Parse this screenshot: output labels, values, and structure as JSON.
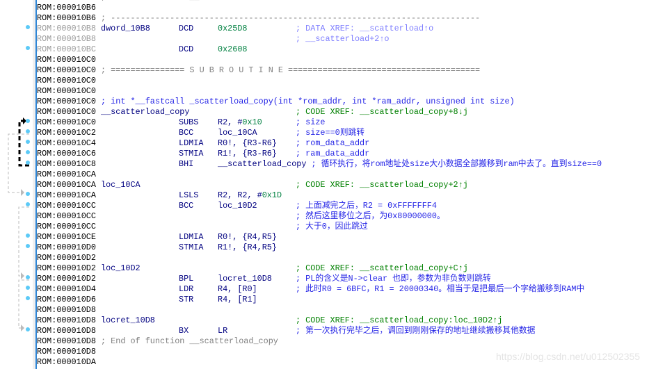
{
  "colors": {
    "address": "#000000",
    "address_dim": "#9a9a9a",
    "label": "#000080",
    "number": "#008040",
    "comment": "#2424e6",
    "xref": "#008000",
    "data_xref": "#8080ff",
    "separator": "#808080",
    "breakpoint_dot": "#5ccaf7",
    "gutter_line": "#2f86d6"
  },
  "rows": [
    {
      "a": "ROM:000010B6",
      "c": "; End of function __scatterload",
      "k": "sep",
      "f": 1
    },
    {
      "a": "ROM:000010B6"
    },
    {
      "a": "ROM:000010B6",
      "c": "; ---------------------------------------------------------------------------",
      "k": "sep",
      "f": 1
    },
    {
      "a": "ROM:000010B8",
      "d": 1,
      "dot": 1,
      "l": "dword_10B8",
      "m": "DCD",
      "o": [
        [
          "0x25D8",
          "num"
        ]
      ],
      "c": "; DATA XREF: __scatterload↑o",
      "k": "dx"
    },
    {
      "a": "ROM:000010B8",
      "d": 1,
      "c": "; __scatterload+2↑o",
      "k": "dx"
    },
    {
      "a": "ROM:000010BC",
      "d": 1,
      "dot": 1,
      "m": "DCD",
      "o": [
        [
          "0x2608",
          "num"
        ]
      ]
    },
    {
      "a": "ROM:000010C0"
    },
    {
      "a": "ROM:000010C0",
      "c": "; =============== S U B R O U T I N E =======================================",
      "k": "sep",
      "f": 1
    },
    {
      "a": "ROM:000010C0"
    },
    {
      "a": "ROM:000010C0"
    },
    {
      "a": "ROM:000010C0",
      "c": "; int *__fastcall _scatterload_copy(int *rom_addr, int *ram_addr, unsigned int size)",
      "k": "proto",
      "f": 1
    },
    {
      "a": "ROM:000010C0",
      "l": "__scatterload_copy",
      "c": "; CODE XREF: __scatterload_copy+8↓j",
      "k": "xref"
    },
    {
      "a": "ROM:000010C0",
      "dot": 1,
      "m": "SUBS",
      "o": [
        [
          "R2, #",
          "reg"
        ],
        [
          "0x10",
          "num"
        ]
      ],
      "c": "; size"
    },
    {
      "a": "ROM:000010C2",
      "dot": 1,
      "m": "BCC",
      "o": [
        [
          "loc_10CA",
          "reg"
        ]
      ],
      "c": "; size==0则跳转"
    },
    {
      "a": "ROM:000010C4",
      "dot": 1,
      "m": "LDMIA",
      "o": [
        [
          "R0!, {R3-R6}",
          "reg"
        ]
      ],
      "c": "; rom_data_addr"
    },
    {
      "a": "ROM:000010C6",
      "dot": 1,
      "m": "STMIA",
      "o": [
        [
          "R1!, {R3-R6}",
          "reg"
        ]
      ],
      "c": "; ram_data_addr"
    },
    {
      "a": "ROM:000010C8",
      "dot": 1,
      "m": "BHI",
      "o": [
        [
          "__scatterload_copy",
          "reg"
        ]
      ],
      "c": "; 循环执行，将rom地址处size大小数据全部搬移到ram中去了。直到size==0"
    },
    {
      "a": "ROM:000010CA"
    },
    {
      "a": "ROM:000010CA",
      "l": "loc_10CA",
      "c": "; CODE XREF: __scatterload_copy+2↑j",
      "k": "xref"
    },
    {
      "a": "ROM:000010CA",
      "dot": 1,
      "m": "LSLS",
      "o": [
        [
          "R2, R2, #",
          "reg"
        ],
        [
          "0x1D",
          "num"
        ]
      ]
    },
    {
      "a": "ROM:000010CC",
      "dot": 1,
      "m": "BCC",
      "o": [
        [
          "loc_10D2",
          "reg"
        ]
      ],
      "c": "; 上面减完之后，R2 = 0xFFFFFFF4"
    },
    {
      "a": "ROM:000010CC",
      "c": "; 然后这里移位之后，为0x80000000。"
    },
    {
      "a": "ROM:000010CC",
      "c": "; 大于0，因此跳过"
    },
    {
      "a": "ROM:000010CE",
      "dot": 1,
      "m": "LDMIA",
      "o": [
        [
          "R0!, {R4,R5}",
          "reg"
        ]
      ]
    },
    {
      "a": "ROM:000010D0",
      "dot": 1,
      "m": "STMIA",
      "o": [
        [
          "R1!, {R4,R5}",
          "reg"
        ]
      ]
    },
    {
      "a": "ROM:000010D2"
    },
    {
      "a": "ROM:000010D2",
      "l": "loc_10D2",
      "c": "; CODE XREF: __scatterload_copy+C↑j",
      "k": "xref"
    },
    {
      "a": "ROM:000010D2",
      "dot": 1,
      "m": "BPL",
      "o": [
        [
          "locret_10D8",
          "reg"
        ]
      ],
      "c": "; PL的含义是N->clear 也即，参数为非负数则跳转"
    },
    {
      "a": "ROM:000010D4",
      "dot": 1,
      "m": "LDR",
      "o": [
        [
          "R4, [R0]",
          "reg"
        ]
      ],
      "c": "; 此时R0 = 6BFC，R1 = 20000340。相当于是把最后一个字给搬移到RAM中"
    },
    {
      "a": "ROM:000010D6",
      "dot": 1,
      "m": "STR",
      "o": [
        [
          "R4, [R1]",
          "reg"
        ]
      ]
    },
    {
      "a": "ROM:000010D8"
    },
    {
      "a": "ROM:000010D8",
      "l": "locret_10D8",
      "c": "; CODE XREF: __scatterload_copy:loc_10D2↑j",
      "k": "xref"
    },
    {
      "a": "ROM:000010D8",
      "dot": 1,
      "m": "BX",
      "o": [
        [
          "LR",
          "reg"
        ]
      ],
      "c": "; 第一次执行完毕之后，调回到刚刚保存的地址继续搬移其他数据"
    },
    {
      "a": "ROM:000010D8",
      "c": "; End of function __scatterload_copy",
      "k": "sep",
      "f": 1
    },
    {
      "a": "ROM:000010D8"
    },
    {
      "a": "ROM:000010DA"
    }
  ],
  "watermark": "https://blog.csdn.net/u012502355"
}
